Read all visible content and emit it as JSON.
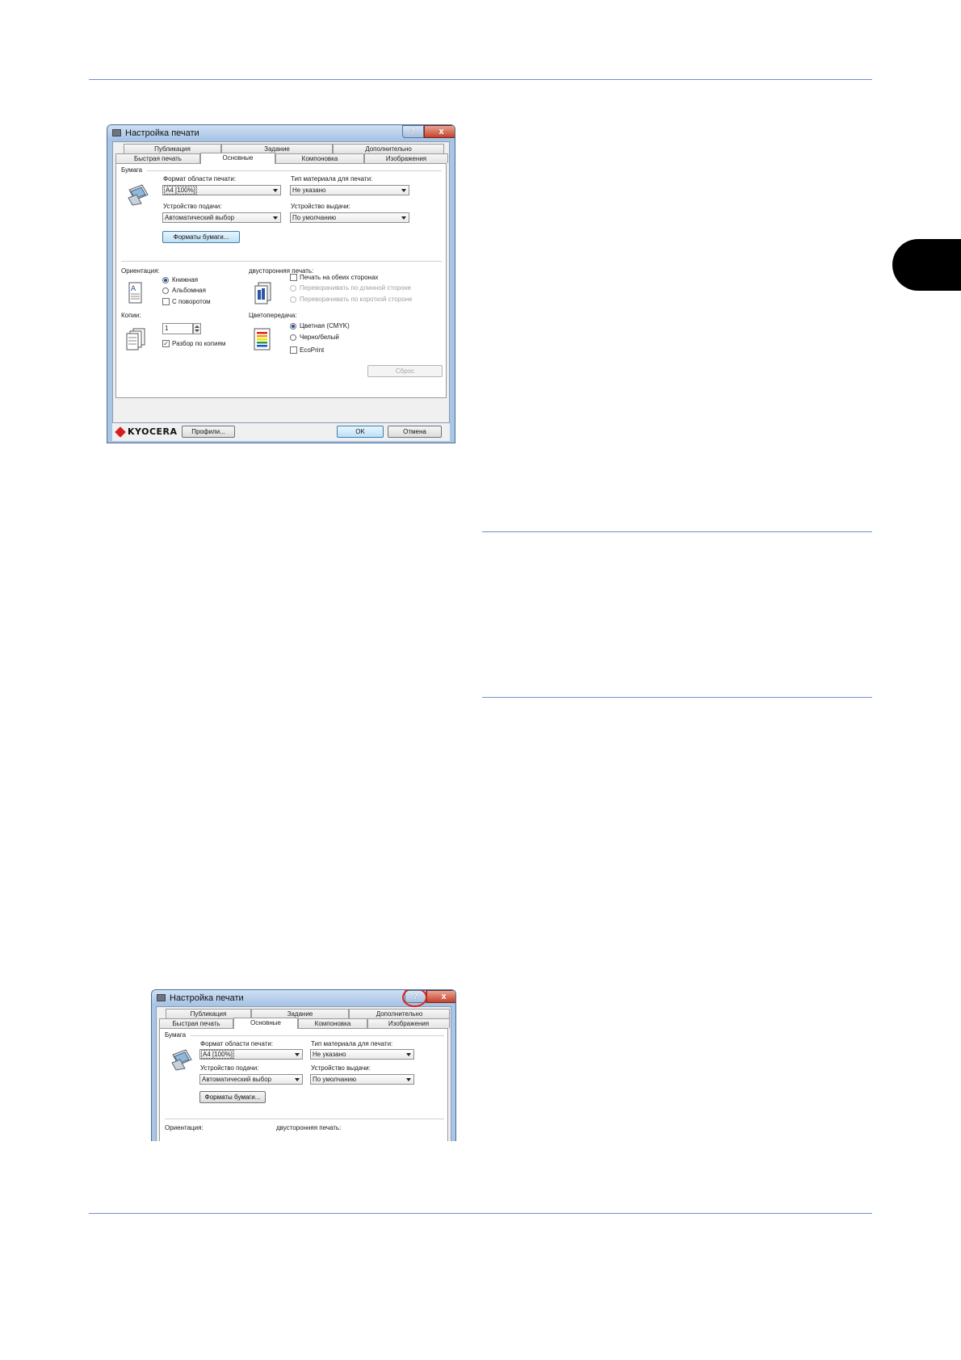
{
  "dialog": {
    "title": "Настройка печати",
    "help_glyph": "?",
    "close_glyph": "x",
    "tabs_top": [
      "Публикация",
      "Задание",
      "Дополнительно"
    ],
    "tabs_bottom": [
      "Быстрая печать",
      "Основные",
      "Компоновка",
      "Изображения"
    ],
    "paper": {
      "group": "Бумага",
      "size_label": "Формат области печати:",
      "size_value": "A4 [100%]",
      "media_label": "Тип материала для печати:",
      "media_value": "Не указано",
      "source_label": "Устройство подачи:",
      "source_value": "Автоматический выбор",
      "output_label": "Устройство выдачи:",
      "output_value": "По умолчанию",
      "sizes_button": "Форматы бумаги..."
    },
    "orientation": {
      "label": "Ориентация:",
      "portrait": "Книжная",
      "landscape": "Альбомная",
      "rotated": "С поворотом"
    },
    "duplex": {
      "label": "двусторонняя печать:",
      "both_sides": "Печать на обеих сторонах",
      "long_edge": "Переворачивать по длинной стороне",
      "short_edge": "Переворачивать по короткой стороне"
    },
    "copies": {
      "label": "Копии:",
      "value": "1",
      "collate": "Разбор по копиям"
    },
    "color": {
      "label": "Цветопередача:",
      "color_cmyk": "Цветная (CMYK)",
      "mono": "Черно/белый",
      "ecoprint": "EcoPrint"
    },
    "reset_button": "Сброс",
    "logo": "KYOCERA",
    "profiles_button": "Профили...",
    "ok_button": "OK",
    "cancel_button": "Отмена"
  },
  "colors": {
    "rule": "#6e8fcf",
    "help_highlight": "#e0221a",
    "kyocera_red": "#d4211f"
  }
}
